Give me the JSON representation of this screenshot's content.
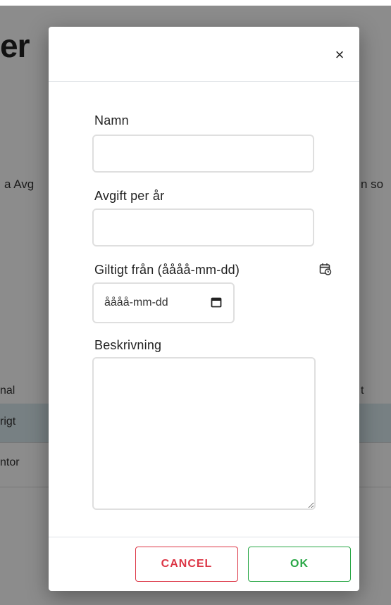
{
  "background": {
    "heading": "er",
    "text_left": "a Avg",
    "text_right": "n so",
    "table_header_left": "nal",
    "table_header_right": "t",
    "rows": [
      "rigt",
      "ntor"
    ]
  },
  "dialog": {
    "close_glyph": "×",
    "fields": {
      "name_label": "Namn",
      "fee_label": "Avgift per år",
      "valid_from_label": "Giltigt från (åååå-mm-dd)",
      "date_placeholder": "åååå-mm-dd",
      "description_label": "Beskrivning"
    },
    "buttons": {
      "cancel": "CANCEL",
      "ok": "OK"
    }
  },
  "colors": {
    "cancel": "#dc3545",
    "ok": "#28a745",
    "row_highlight": "#d9e9ee"
  },
  "icons": {
    "close": "close-icon",
    "label_calendar": "calendar-clock-icon",
    "date_picker": "calendar-icon"
  }
}
